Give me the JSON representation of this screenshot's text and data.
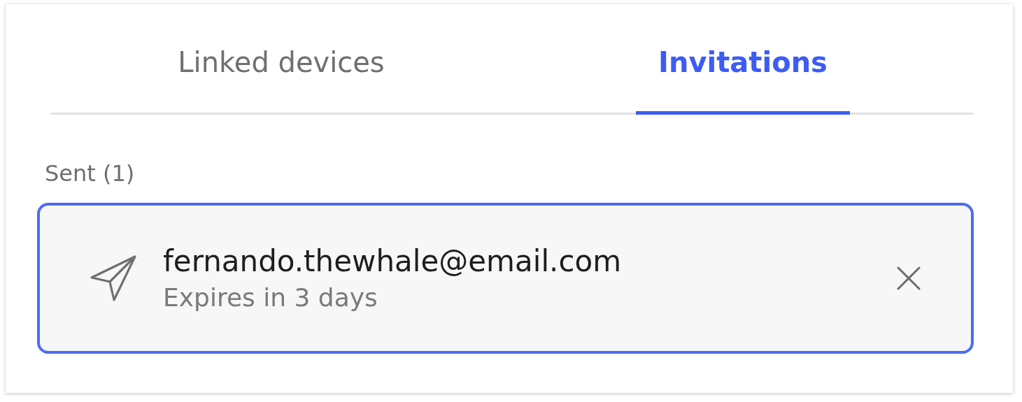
{
  "tabs": [
    {
      "label": "Linked devices",
      "selected": false
    },
    {
      "label": "Invitations",
      "selected": true
    }
  ],
  "sent_section": {
    "heading": "Sent (1)",
    "invitations": [
      {
        "email": "fernando.thewhale@email.com",
        "expiry": "Expires in 3 days",
        "selected": true
      }
    ]
  }
}
